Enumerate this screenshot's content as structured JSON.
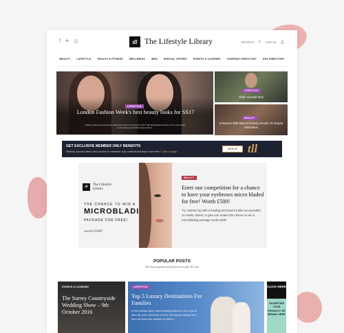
{
  "header": {
    "logo_mark": "tll",
    "logo_text": "The Lifestyle Library",
    "search_label": "SEARCH",
    "login_label": "LOG IN",
    "social_icons": [
      "facebook-icon",
      "twitter-icon",
      "instagram-icon"
    ]
  },
  "nav": {
    "items": [
      "BEAUTY",
      "LIFESTYLE",
      "HEALTH & FITNESS",
      "WELLBEING",
      "MEN",
      "SPECIAL OFFERS",
      "EVENTS & COURSES",
      "COMPANY DIRECTORY",
      "SPA DIRECTORY"
    ]
  },
  "hero": {
    "tag": "LIFESTYLE",
    "title": "London Fashion Week's best beauty looks for SS17",
    "desc": "Classic spring summer beauty was given a shot of energy for 2017 with ambassador beauty. From natural skin, nude makeup and bold colour looks to..."
  },
  "side_articles": [
    {
      "tag": "LIFESTYLE",
      "title": "Think Yourself Rich"
    },
    {
      "tag": "BEAUTY",
      "title": "5 Minutes With Mind And Body Genius: Dr Galyna Selezneva"
    }
  ],
  "member_banner": {
    "heading": "GET EXCLUSIVE MEMBER ONLY BENEFITS",
    "sub": "Weekly special offers and access to member only content Already a member?",
    "login_link": "Click to login.",
    "signup_label": "SIGN UP",
    "mark": "tll"
  },
  "promo": {
    "logo_mark": "tll",
    "logo_text_1": "The Lifestyle",
    "logo_text_2": "Library",
    "chance": "THE CHANCE TO WIN A",
    "product": "MICROBLADING",
    "package": "PACKAGE FOR FREE!",
    "worth": "worth £500!",
    "tag": "BEAUTY",
    "headline": "Enter our competition for a chance to have your eyebrows micro bladed for free! Worth £500!",
    "body": "TLL teamed up with a leading permanent make-up specialist on Harley Street, to give one reader the chance to win a microblading package worth £500!"
  },
  "popular": {
    "title": "POPULAR POSTS",
    "subtitle": "The latest popular posts from across the TLL site",
    "cards": [
      {
        "label": "EVENTS & COURSES",
        "title": "The Surrey Countryside Wedding Show – 9th October 2016"
      },
      {
        "label": "LIFESTYLE",
        "title": "Top 5 Luxury Destinations For Families",
        "body": "If the holiday blues have already kicked in, the urge to plan for your next dose of time off may be taking over, then we have the answer to where..."
      }
    ]
  },
  "ad": {
    "top": "CLICK HERE",
    "bottom": "ADVERTISE YOUR PRODUCT OR BRAND HERE"
  }
}
